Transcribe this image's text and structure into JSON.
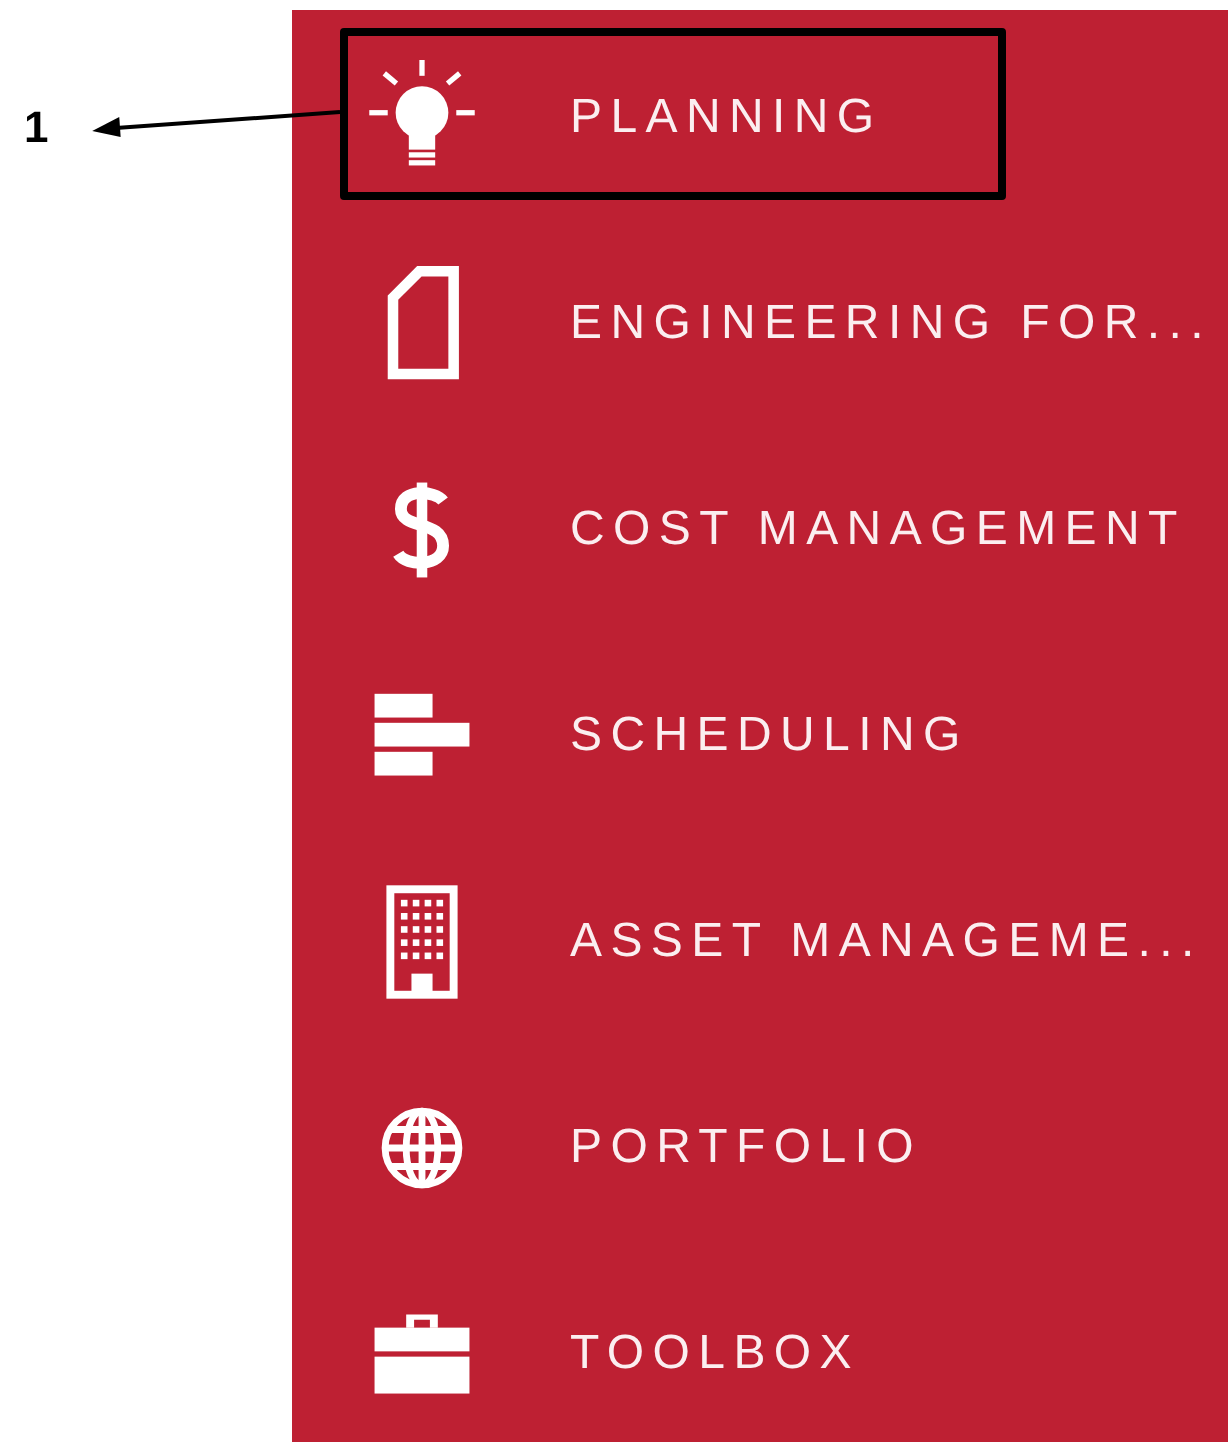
{
  "callout": {
    "label": "1"
  },
  "menu": [
    {
      "label": "PLANNING",
      "annotated": true
    },
    {
      "label": "ENGINEERING FOR...",
      "annotated": false
    },
    {
      "label": "COST MANAGEMENT",
      "annotated": false
    },
    {
      "label": "SCHEDULING",
      "annotated": false
    },
    {
      "label": "ASSET MANAGEME...",
      "annotated": false
    },
    {
      "label": "PORTFOLIO",
      "annotated": false
    },
    {
      "label": "TOOLBOX",
      "annotated": false
    }
  ]
}
